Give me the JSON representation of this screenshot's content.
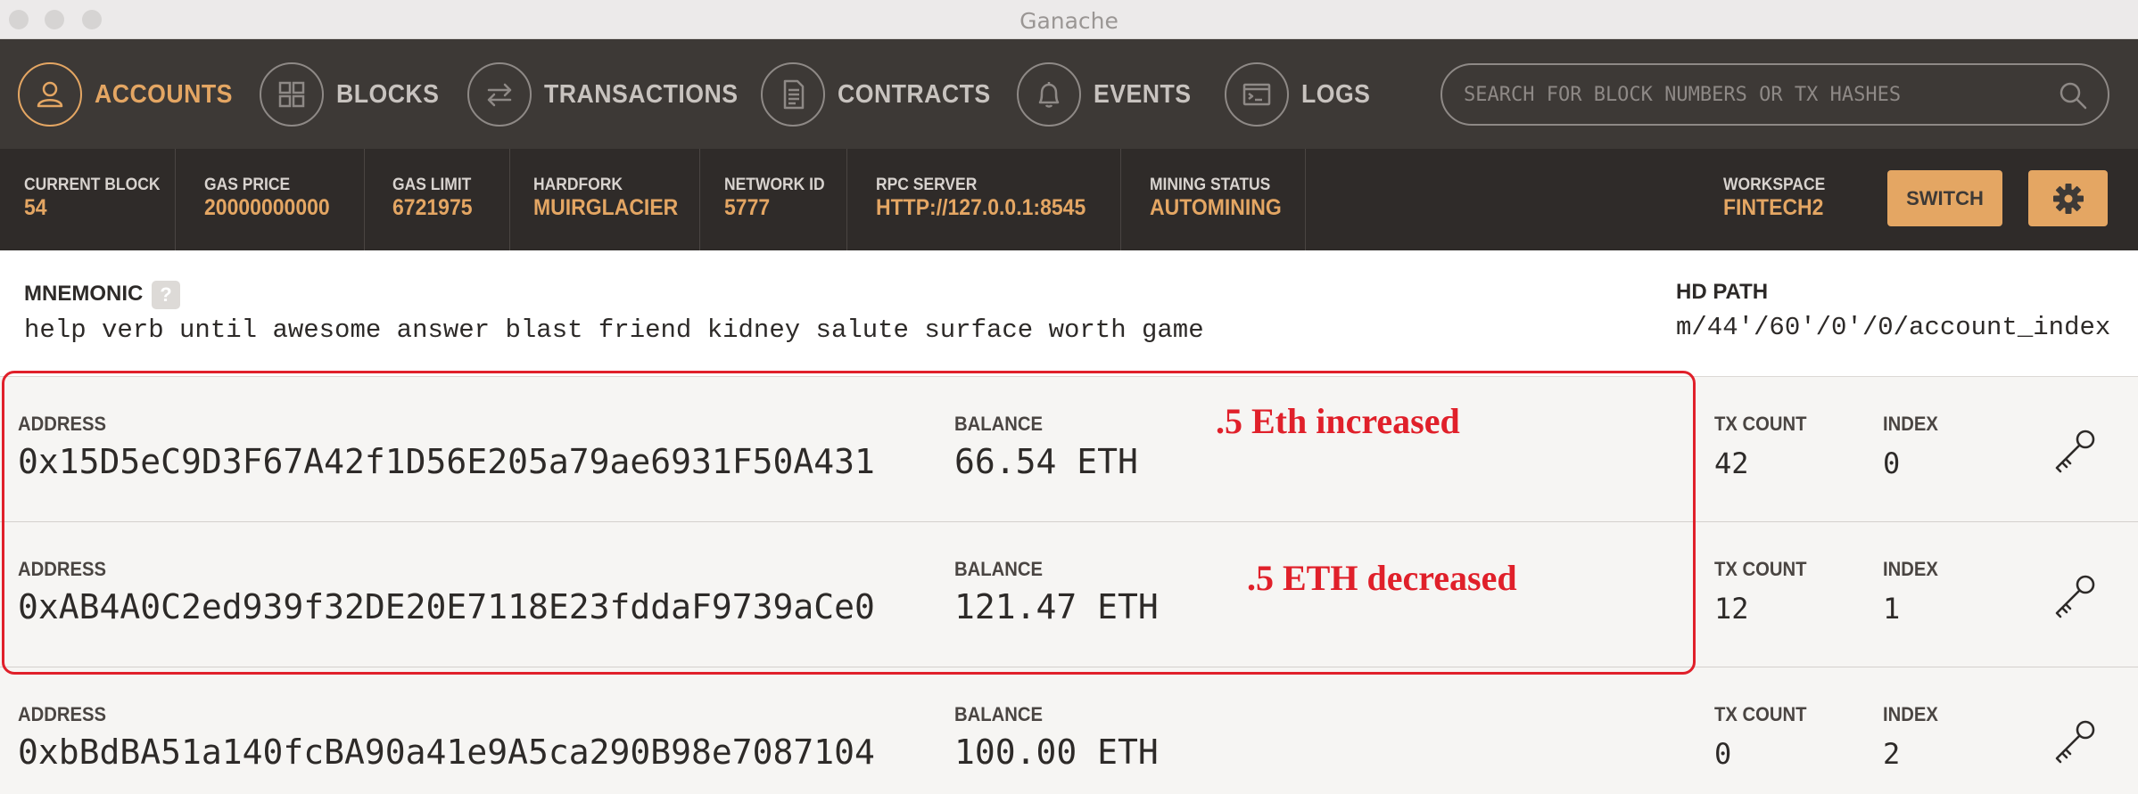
{
  "window": {
    "title": "Ganache"
  },
  "nav": {
    "items": [
      {
        "label": "ACCOUNTS",
        "icon": "account-icon",
        "active": true
      },
      {
        "label": "BLOCKS",
        "icon": "blocks-icon"
      },
      {
        "label": "TRANSACTIONS",
        "icon": "transactions-icon"
      },
      {
        "label": "CONTRACTS",
        "icon": "contracts-icon"
      },
      {
        "label": "EVENTS",
        "icon": "bell-icon"
      },
      {
        "label": "LOGS",
        "icon": "terminal-icon"
      }
    ],
    "search_placeholder": "SEARCH FOR BLOCK NUMBERS OR TX HASHES"
  },
  "status": {
    "items": [
      {
        "label": "CURRENT BLOCK",
        "value": "54"
      },
      {
        "label": "GAS PRICE",
        "value": "20000000000"
      },
      {
        "label": "GAS LIMIT",
        "value": "6721975"
      },
      {
        "label": "HARDFORK",
        "value": "MUIRGLACIER"
      },
      {
        "label": "NETWORK ID",
        "value": "5777"
      },
      {
        "label": "RPC SERVER",
        "value": "HTTP://127.0.0.1:8545"
      },
      {
        "label": "MINING STATUS",
        "value": "AUTOMINING"
      }
    ],
    "workspace_label": "WORKSPACE",
    "workspace_value": "FINTECH2",
    "switch_label": "SWITCH"
  },
  "mnemonic": {
    "label": "MNEMONIC",
    "help": "?",
    "words": "help verb until awesome answer blast friend kidney salute surface worth game",
    "hd_label": "HD PATH",
    "hd_path": "m/44'/60'/0'/0/account_index"
  },
  "columns": {
    "address": "ADDRESS",
    "balance": "BALANCE",
    "tx_count": "TX COUNT",
    "index": "INDEX"
  },
  "accounts": [
    {
      "address": "0x15D5eC9D3F67A42f1D56E205a79ae6931F50A431",
      "balance": "66.54 ETH",
      "tx_count": "42",
      "index": "0"
    },
    {
      "address": "0xAB4A0C2ed939f32DE20E7118E23fddaF9739aCe0",
      "balance": "121.47 ETH",
      "tx_count": "12",
      "index": "1"
    },
    {
      "address": "0xbBdBA51a140fcBA90a41e9A5ca290B98e7087104",
      "balance": "100.00 ETH",
      "tx_count": "0",
      "index": "2"
    }
  ],
  "annotations": {
    "first": ".5 Eth increased",
    "second": ".5 ETH decreased",
    "color": "#e0202a"
  },
  "colors": {
    "accent": "#e4a663",
    "nav_bg": "#3d3936",
    "status_bg": "#2f2b29"
  }
}
